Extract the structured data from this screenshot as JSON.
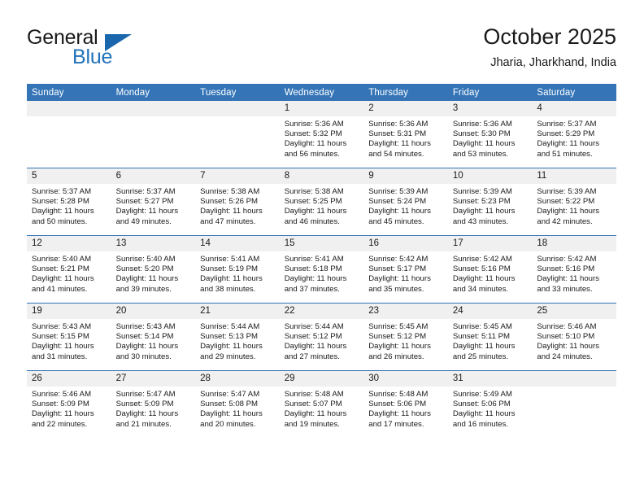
{
  "brand": {
    "name_part1": "General",
    "name_part2": "Blue",
    "triangle_icon": "triangle-icon",
    "accent_color": "#2272bb"
  },
  "header": {
    "title": "October 2025",
    "subtitle": "Jharia, Jharkhand, India"
  },
  "calendar": {
    "header_bg": "#3575b7",
    "row_separator_color": "#2f72b4",
    "daynum_bg": "#f0f0f0",
    "weekdays": [
      "Sunday",
      "Monday",
      "Tuesday",
      "Wednesday",
      "Thursday",
      "Friday",
      "Saturday"
    ],
    "weeks": [
      [
        {
          "day": "",
          "lines": []
        },
        {
          "day": "",
          "lines": []
        },
        {
          "day": "",
          "lines": []
        },
        {
          "day": "1",
          "lines": [
            "Sunrise: 5:36 AM",
            "Sunset: 5:32 PM",
            "Daylight: 11 hours",
            "and 56 minutes."
          ]
        },
        {
          "day": "2",
          "lines": [
            "Sunrise: 5:36 AM",
            "Sunset: 5:31 PM",
            "Daylight: 11 hours",
            "and 54 minutes."
          ]
        },
        {
          "day": "3",
          "lines": [
            "Sunrise: 5:36 AM",
            "Sunset: 5:30 PM",
            "Daylight: 11 hours",
            "and 53 minutes."
          ]
        },
        {
          "day": "4",
          "lines": [
            "Sunrise: 5:37 AM",
            "Sunset: 5:29 PM",
            "Daylight: 11 hours",
            "and 51 minutes."
          ]
        }
      ],
      [
        {
          "day": "5",
          "lines": [
            "Sunrise: 5:37 AM",
            "Sunset: 5:28 PM",
            "Daylight: 11 hours",
            "and 50 minutes."
          ]
        },
        {
          "day": "6",
          "lines": [
            "Sunrise: 5:37 AM",
            "Sunset: 5:27 PM",
            "Daylight: 11 hours",
            "and 49 minutes."
          ]
        },
        {
          "day": "7",
          "lines": [
            "Sunrise: 5:38 AM",
            "Sunset: 5:26 PM",
            "Daylight: 11 hours",
            "and 47 minutes."
          ]
        },
        {
          "day": "8",
          "lines": [
            "Sunrise: 5:38 AM",
            "Sunset: 5:25 PM",
            "Daylight: 11 hours",
            "and 46 minutes."
          ]
        },
        {
          "day": "9",
          "lines": [
            "Sunrise: 5:39 AM",
            "Sunset: 5:24 PM",
            "Daylight: 11 hours",
            "and 45 minutes."
          ]
        },
        {
          "day": "10",
          "lines": [
            "Sunrise: 5:39 AM",
            "Sunset: 5:23 PM",
            "Daylight: 11 hours",
            "and 43 minutes."
          ]
        },
        {
          "day": "11",
          "lines": [
            "Sunrise: 5:39 AM",
            "Sunset: 5:22 PM",
            "Daylight: 11 hours",
            "and 42 minutes."
          ]
        }
      ],
      [
        {
          "day": "12",
          "lines": [
            "Sunrise: 5:40 AM",
            "Sunset: 5:21 PM",
            "Daylight: 11 hours",
            "and 41 minutes."
          ]
        },
        {
          "day": "13",
          "lines": [
            "Sunrise: 5:40 AM",
            "Sunset: 5:20 PM",
            "Daylight: 11 hours",
            "and 39 minutes."
          ]
        },
        {
          "day": "14",
          "lines": [
            "Sunrise: 5:41 AM",
            "Sunset: 5:19 PM",
            "Daylight: 11 hours",
            "and 38 minutes."
          ]
        },
        {
          "day": "15",
          "lines": [
            "Sunrise: 5:41 AM",
            "Sunset: 5:18 PM",
            "Daylight: 11 hours",
            "and 37 minutes."
          ]
        },
        {
          "day": "16",
          "lines": [
            "Sunrise: 5:42 AM",
            "Sunset: 5:17 PM",
            "Daylight: 11 hours",
            "and 35 minutes."
          ]
        },
        {
          "day": "17",
          "lines": [
            "Sunrise: 5:42 AM",
            "Sunset: 5:16 PM",
            "Daylight: 11 hours",
            "and 34 minutes."
          ]
        },
        {
          "day": "18",
          "lines": [
            "Sunrise: 5:42 AM",
            "Sunset: 5:16 PM",
            "Daylight: 11 hours",
            "and 33 minutes."
          ]
        }
      ],
      [
        {
          "day": "19",
          "lines": [
            "Sunrise: 5:43 AM",
            "Sunset: 5:15 PM",
            "Daylight: 11 hours",
            "and 31 minutes."
          ]
        },
        {
          "day": "20",
          "lines": [
            "Sunrise: 5:43 AM",
            "Sunset: 5:14 PM",
            "Daylight: 11 hours",
            "and 30 minutes."
          ]
        },
        {
          "day": "21",
          "lines": [
            "Sunrise: 5:44 AM",
            "Sunset: 5:13 PM",
            "Daylight: 11 hours",
            "and 29 minutes."
          ]
        },
        {
          "day": "22",
          "lines": [
            "Sunrise: 5:44 AM",
            "Sunset: 5:12 PM",
            "Daylight: 11 hours",
            "and 27 minutes."
          ]
        },
        {
          "day": "23",
          "lines": [
            "Sunrise: 5:45 AM",
            "Sunset: 5:12 PM",
            "Daylight: 11 hours",
            "and 26 minutes."
          ]
        },
        {
          "day": "24",
          "lines": [
            "Sunrise: 5:45 AM",
            "Sunset: 5:11 PM",
            "Daylight: 11 hours",
            "and 25 minutes."
          ]
        },
        {
          "day": "25",
          "lines": [
            "Sunrise: 5:46 AM",
            "Sunset: 5:10 PM",
            "Daylight: 11 hours",
            "and 24 minutes."
          ]
        }
      ],
      [
        {
          "day": "26",
          "lines": [
            "Sunrise: 5:46 AM",
            "Sunset: 5:09 PM",
            "Daylight: 11 hours",
            "and 22 minutes."
          ]
        },
        {
          "day": "27",
          "lines": [
            "Sunrise: 5:47 AM",
            "Sunset: 5:09 PM",
            "Daylight: 11 hours",
            "and 21 minutes."
          ]
        },
        {
          "day": "28",
          "lines": [
            "Sunrise: 5:47 AM",
            "Sunset: 5:08 PM",
            "Daylight: 11 hours",
            "and 20 minutes."
          ]
        },
        {
          "day": "29",
          "lines": [
            "Sunrise: 5:48 AM",
            "Sunset: 5:07 PM",
            "Daylight: 11 hours",
            "and 19 minutes."
          ]
        },
        {
          "day": "30",
          "lines": [
            "Sunrise: 5:48 AM",
            "Sunset: 5:06 PM",
            "Daylight: 11 hours",
            "and 17 minutes."
          ]
        },
        {
          "day": "31",
          "lines": [
            "Sunrise: 5:49 AM",
            "Sunset: 5:06 PM",
            "Daylight: 11 hours",
            "and 16 minutes."
          ]
        },
        {
          "day": "",
          "lines": []
        }
      ]
    ]
  }
}
